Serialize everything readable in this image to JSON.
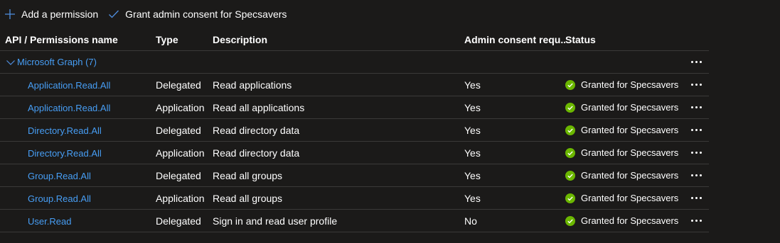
{
  "toolbar": {
    "add_permission_label": "Add a permission",
    "grant_consent_label": "Grant admin consent for Specsavers"
  },
  "table": {
    "headers": {
      "name": "API / Permissions name",
      "type": "Type",
      "description": "Description",
      "admin_consent": "Admin consent requ...",
      "status": "Status"
    },
    "group": {
      "label": "Microsoft Graph (7)"
    },
    "rows": [
      {
        "name": "Application.Read.All",
        "type": "Delegated",
        "description": "Read applications",
        "admin_consent": "Yes",
        "status": "Granted for Specsavers"
      },
      {
        "name": "Application.Read.All",
        "type": "Application",
        "description": "Read all applications",
        "admin_consent": "Yes",
        "status": "Granted for Specsavers"
      },
      {
        "name": "Directory.Read.All",
        "type": "Delegated",
        "description": "Read directory data",
        "admin_consent": "Yes",
        "status": "Granted for Specsavers"
      },
      {
        "name": "Directory.Read.All",
        "type": "Application",
        "description": "Read directory data",
        "admin_consent": "Yes",
        "status": "Granted for Specsavers"
      },
      {
        "name": "Group.Read.All",
        "type": "Delegated",
        "description": "Read all groups",
        "admin_consent": "Yes",
        "status": "Granted for Specsavers"
      },
      {
        "name": "Group.Read.All",
        "type": "Application",
        "description": "Read all groups",
        "admin_consent": "Yes",
        "status": "Granted for Specsavers"
      },
      {
        "name": "User.Read",
        "type": "Delegated",
        "description": "Sign in and read user profile",
        "admin_consent": "No",
        "status": "Granted for Specsavers"
      }
    ]
  },
  "colors": {
    "background": "#1b1a19",
    "link": "#479ef5",
    "accent": "#4f8fe0",
    "status_ok": "#6bb700",
    "divider": "#3b3a39"
  },
  "icons": {
    "add": "plus-icon",
    "grant": "checkmark-icon",
    "group_toggle": "chevron-down-icon",
    "status": "checkmark-circle-icon",
    "more": "more-icon"
  }
}
